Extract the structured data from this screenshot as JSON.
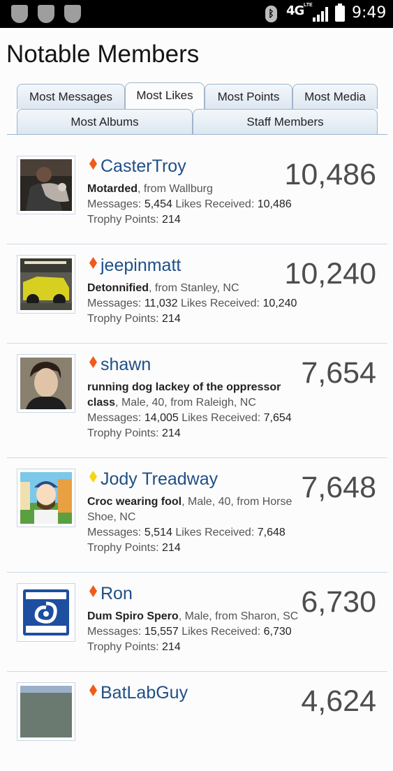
{
  "status_bar": {
    "network": "4G",
    "network_sub": "LTE",
    "time": "9:49"
  },
  "page": {
    "title": "Notable Members"
  },
  "tabs": [
    {
      "label": "Most Messages",
      "active": false
    },
    {
      "label": "Most Likes",
      "active": true
    },
    {
      "label": "Most Points",
      "active": false
    },
    {
      "label": "Most Media",
      "active": false
    },
    {
      "label": "Most Albums",
      "active": false
    },
    {
      "label": "Staff Members",
      "active": false
    }
  ],
  "labels": {
    "messages": "Messages:",
    "likes_received": "Likes Received:",
    "trophy_points": "Trophy Points:"
  },
  "members": [
    {
      "name": "CasterTroy",
      "rank_color": "#f05a1a",
      "user_title": "Motarded",
      "details": ", from Wallburg",
      "messages": "5,454",
      "likes_received": "10,486",
      "trophy_points": "214",
      "score": "10,486"
    },
    {
      "name": "jeepinmatt",
      "rank_color": "#f05a1a",
      "user_title": "Detonnified",
      "details": ", from Stanley, NC",
      "messages": "11,032",
      "likes_received": "10,240",
      "trophy_points": "214",
      "score": "10,240"
    },
    {
      "name": "shawn",
      "rank_color": "#f05a1a",
      "user_title": "running dog lackey of the oppressor class",
      "details": ", Male, 40, from Raleigh, NC",
      "messages": "14,005",
      "likes_received": "7,654",
      "trophy_points": "214",
      "score": "7,654"
    },
    {
      "name": "Jody Treadway",
      "rank_color": "#f5d60f",
      "user_title": "Croc wearing fool",
      "details": ", Male, 40, from Horse Shoe, NC",
      "messages": "5,514",
      "likes_received": "7,648",
      "trophy_points": "214",
      "score": "7,648"
    },
    {
      "name": "Ron",
      "rank_color": "#f05a1a",
      "user_title": "Dum Spiro Spero",
      "details": ", Male, from Sharon, SC",
      "messages": "15,557",
      "likes_received": "6,730",
      "trophy_points": "214",
      "score": "6,730"
    },
    {
      "name": "BatLabGuy",
      "rank_color": "#f05a1a",
      "user_title": "",
      "details": "",
      "messages": "",
      "likes_received": "",
      "trophy_points": "",
      "score": "4,624"
    }
  ],
  "colors": {
    "link": "#1f4f86",
    "tab_border": "#9fb5cc",
    "rank_orange": "#f05a1a",
    "rank_yellow": "#f5d60f"
  }
}
